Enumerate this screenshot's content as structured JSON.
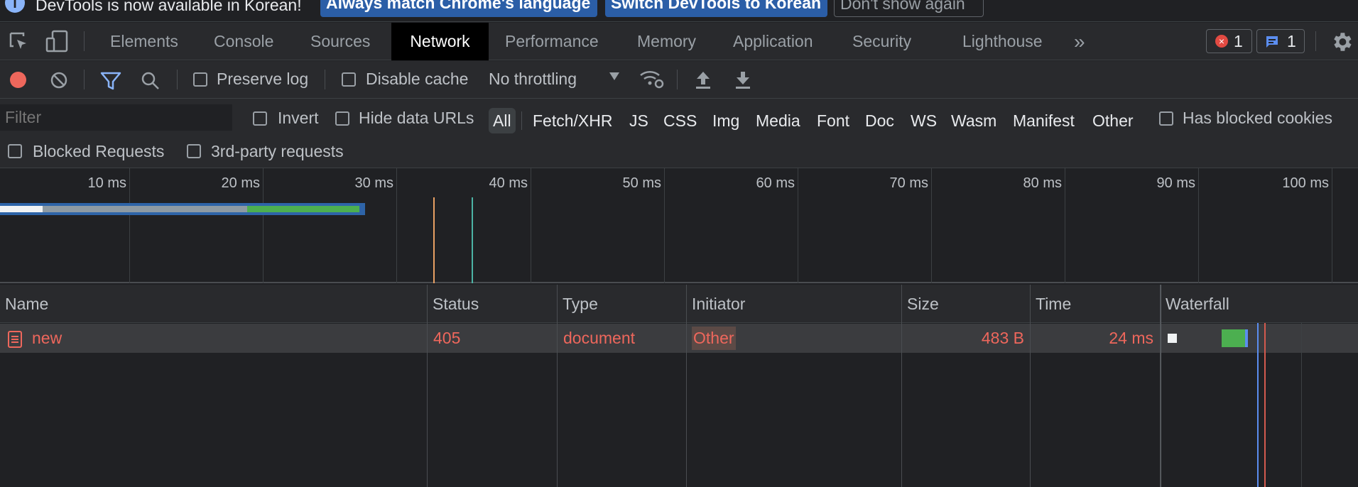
{
  "infobar": {
    "message": "DevTools is now available in Korean!",
    "match_language_btn": "Always match Chrome's language",
    "switch_btn": "Switch DevTools to Korean",
    "dismiss_btn": "Don't show again"
  },
  "tabs": [
    "Elements",
    "Console",
    "Sources",
    "Network",
    "Performance",
    "Memory",
    "Application",
    "Security",
    "Lighthouse"
  ],
  "active_tab": "Network",
  "badges": {
    "errors": "1",
    "messages": "1"
  },
  "toolbar": {
    "preserve_log": "Preserve log",
    "disable_cache": "Disable cache",
    "throttling": "No throttling"
  },
  "filter": {
    "placeholder": "Filter",
    "invert": "Invert",
    "hide_data_urls": "Hide data URLs",
    "types": [
      "All",
      "Fetch/XHR",
      "JS",
      "CSS",
      "Img",
      "Media",
      "Font",
      "Doc",
      "WS",
      "Wasm",
      "Manifest",
      "Other"
    ],
    "selected_type": "All",
    "has_blocked_cookies": "Has blocked cookies",
    "blocked_requests": "Blocked Requests",
    "third_party": "3rd-party requests"
  },
  "overview": {
    "ticks": [
      "10 ms",
      "20 ms",
      "30 ms",
      "40 ms",
      "50 ms",
      "60 ms",
      "70 ms",
      "80 ms",
      "90 ms",
      "100 ms"
    ],
    "dom_content_loaded_ms": 32.0,
    "load_ms": 35.0
  },
  "table": {
    "columns": [
      "Name",
      "Status",
      "Type",
      "Initiator",
      "Size",
      "Time",
      "Waterfall"
    ],
    "rows": [
      {
        "name": "new",
        "status": "405",
        "type": "document",
        "initiator": "Other",
        "size": "483 B",
        "time": "24 ms"
      }
    ]
  },
  "colors": {
    "error": "#ee675c",
    "accent": "#8ab4f8",
    "record": "#ee675c",
    "waterfall_receive": "#4caf50",
    "waterfall_wait": "#80868b",
    "dcl_line": "#4cb3a5",
    "load_line": "#e8a063"
  }
}
